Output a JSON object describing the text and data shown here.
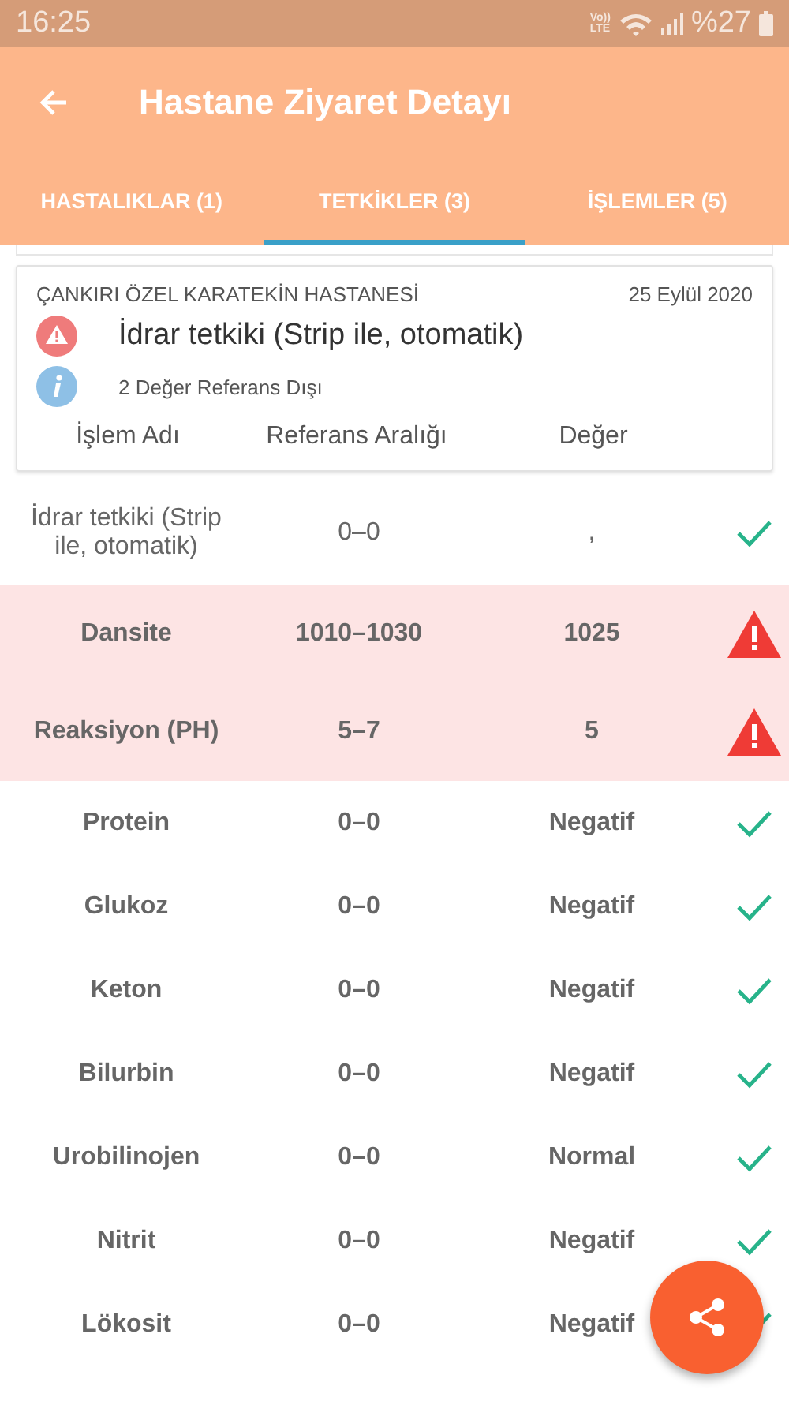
{
  "status_bar": {
    "time": "16:25",
    "volte_top": "Vo))",
    "volte_bottom": "LTE",
    "battery": "%27"
  },
  "app_bar": {
    "title": "Hastane Ziyaret Detayı"
  },
  "tabs": [
    {
      "label": "HASTALIKLAR (1)",
      "selected": false
    },
    {
      "label": "TETKİKLER (3)",
      "selected": true
    },
    {
      "label": "İŞLEMLER (5)",
      "selected": false
    }
  ],
  "card": {
    "hospital": "ÇANKIRI ÖZEL KARATEKİN HASTANESİ",
    "date": "25 Eylül 2020",
    "test_name": "İdrar tetkiki (Strip ile, otomatik)",
    "info": "2 Değer Referans Dışı",
    "columns": [
      "İşlem Adı",
      "Referans Aralığı",
      "Değer"
    ]
  },
  "rows": [
    {
      "name": "İdrar tetkiki (Strip ile, otomatik)",
      "range": "0–0",
      "value": ",",
      "out_of_range": false
    },
    {
      "name": "Dansite",
      "range": "1010–1030",
      "value": "1025",
      "out_of_range": true
    },
    {
      "name": "Reaksiyon (PH)",
      "range": "5–7",
      "value": "5",
      "out_of_range": true
    },
    {
      "name": "Protein",
      "range": "0–0",
      "value": "Negatif",
      "out_of_range": false
    },
    {
      "name": "Glukoz",
      "range": "0–0",
      "value": "Negatif",
      "out_of_range": false
    },
    {
      "name": "Keton",
      "range": "0–0",
      "value": "Negatif",
      "out_of_range": false
    },
    {
      "name": "Bilurbin",
      "range": "0–0",
      "value": "Negatif",
      "out_of_range": false
    },
    {
      "name": "Urobilinojen",
      "range": "0–0",
      "value": "Normal",
      "out_of_range": false
    },
    {
      "name": "Nitrit",
      "range": "0–0",
      "value": "Negatif",
      "out_of_range": false
    },
    {
      "name": "Lökosit",
      "range": "0–0",
      "value": "Negatif",
      "out_of_range": false
    }
  ]
}
